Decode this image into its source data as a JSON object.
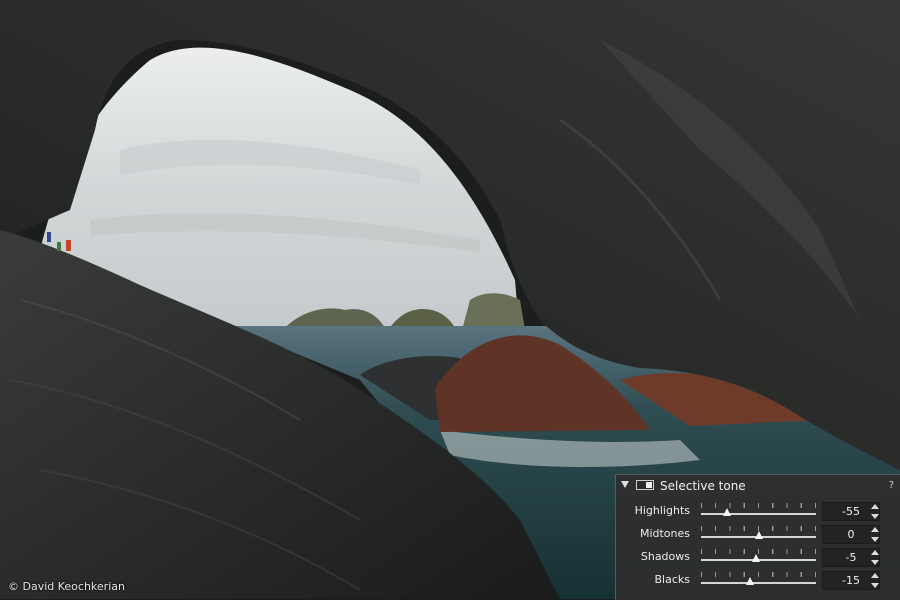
{
  "photo": {
    "credit": "© David Keochkerian",
    "colors": {
      "sky": "#dadcdc",
      "rock_dark": "#2a2d2b",
      "sea": "#1f3b3d",
      "red_rock": "#6b3a2c"
    }
  },
  "panel": {
    "title": "Selective tone",
    "help": "?",
    "rows": [
      {
        "label": "Highlights",
        "value": "-55",
        "level": -55
      },
      {
        "label": "Midtones",
        "value": "0",
        "level": 0
      },
      {
        "label": "Shadows",
        "value": "-5",
        "level": -5
      },
      {
        "label": "Blacks",
        "value": "-15",
        "level": -15
      }
    ]
  }
}
